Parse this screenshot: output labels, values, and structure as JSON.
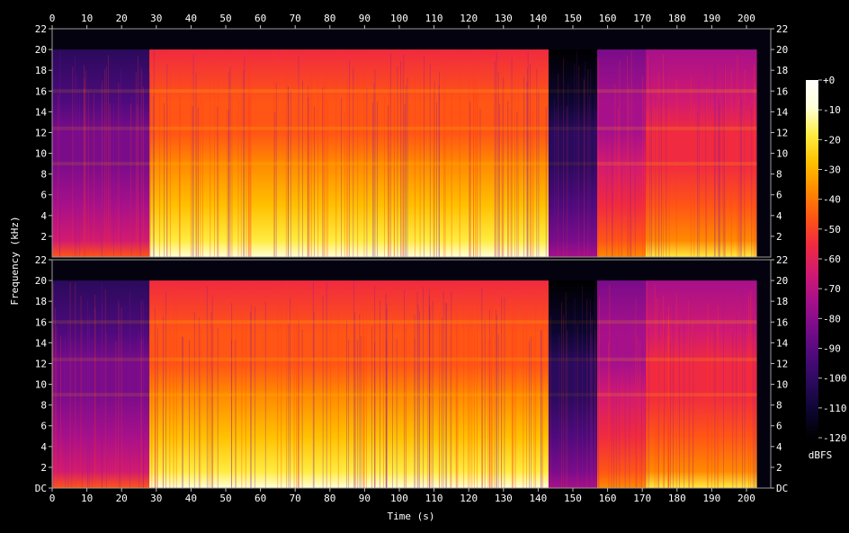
{
  "chart_data": {
    "type": "heatmap",
    "title": "",
    "xlabel": "Time (s)",
    "ylabel": "Frequency (kHz)",
    "xlim": [
      0,
      207
    ],
    "ylim": [
      0,
      22
    ],
    "x_ticks": [
      "0",
      "10",
      "20",
      "30",
      "40",
      "50",
      "60",
      "70",
      "80",
      "90",
      "100",
      "110",
      "120",
      "130",
      "140",
      "150",
      "160",
      "170",
      "180",
      "190",
      "200"
    ],
    "y_ticks": [
      "DC",
      "2",
      "4",
      "6",
      "8",
      "10",
      "12",
      "14",
      "16",
      "18",
      "20",
      "22"
    ],
    "channels": [
      "top",
      "bottom"
    ],
    "colorbar": {
      "label": "dBFS",
      "ticks": [
        "+0",
        "-10",
        "-20",
        "-30",
        "-40",
        "-50",
        "-60",
        "-70",
        "-80",
        "-90",
        "-100",
        "-110",
        "-120"
      ],
      "range": [
        -120,
        0
      ],
      "colors": [
        "#000000",
        "#0c0631",
        "#2a0a5c",
        "#4e0a7c",
        "#7a0c8a",
        "#a8108a",
        "#d21a70",
        "#f02a40",
        "#ff5515",
        "#ff8a00",
        "#ffc000",
        "#ffec40",
        "#ffffd8",
        "#ffffff"
      ]
    },
    "segments": [
      {
        "start": 0,
        "end": 28,
        "cutoff_khz": 20,
        "level": 0.36
      },
      {
        "start": 28,
        "end": 143,
        "cutoff_khz": 20,
        "level": 0.72
      },
      {
        "start": 143,
        "end": 157,
        "cutoff_khz": 20,
        "level": 0.2
      },
      {
        "start": 157,
        "end": 171,
        "cutoff_khz": 20,
        "level": 0.5
      },
      {
        "start": 171,
        "end": 203,
        "cutoff_khz": 20,
        "level": 0.6
      }
    ]
  }
}
